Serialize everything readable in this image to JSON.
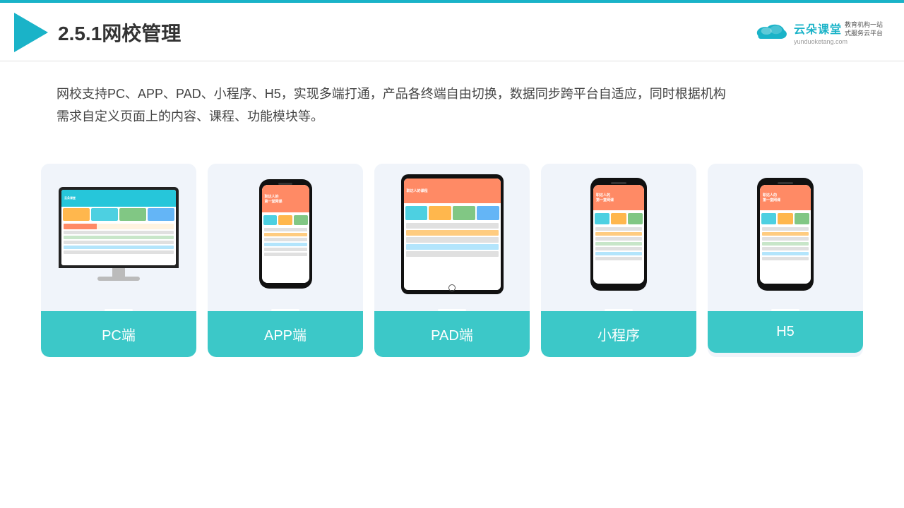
{
  "topLine": {},
  "header": {
    "title": "2.5.1网校管理",
    "brand": {
      "name": "云朵课堂",
      "url": "yunduoketang.com",
      "slogan": "教育机构一站\n式服务云平台"
    }
  },
  "description": {
    "text": "网校支持PC、APP、PAD、小程序、H5，实现多端打通，产品各终端自由切换，数据同步跨平台自适应，同时根据机构\n需求自定义页面上的内容、课程、功能模块等。"
  },
  "cards": [
    {
      "id": "pc",
      "label": "PC端"
    },
    {
      "id": "app",
      "label": "APP端"
    },
    {
      "id": "pad",
      "label": "PAD端"
    },
    {
      "id": "miniprogram",
      "label": "小程序"
    },
    {
      "id": "h5",
      "label": "H5"
    }
  ],
  "colors": {
    "accent": "#1ab3c8",
    "cardBg": "#f0f4fa",
    "labelBg": "#3cc8c8",
    "white": "#ffffff"
  }
}
